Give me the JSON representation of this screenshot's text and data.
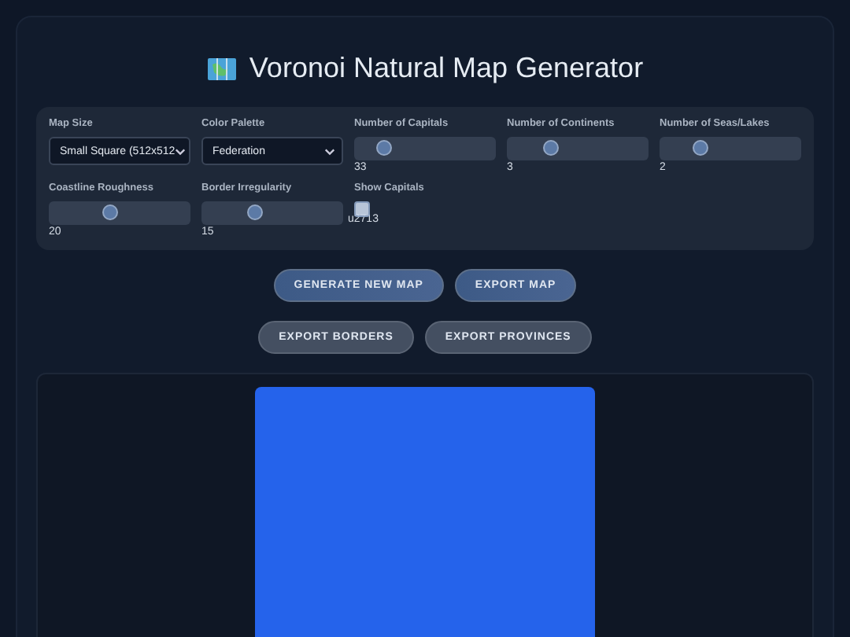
{
  "title": "Voronoi Natural Map Generator",
  "controls": [
    {
      "kind": "select",
      "label": "Map Size",
      "value": "Small Square (512x512"
    },
    {
      "kind": "select",
      "label": "Color Palette",
      "value": "Federation"
    },
    {
      "kind": "slider",
      "label": "Number of Capitals",
      "level": 0.12,
      "reading": "33"
    },
    {
      "kind": "slider",
      "label": "Number of Continents",
      "level": 0.25,
      "reading": "3"
    },
    {
      "kind": "slider",
      "label": "Number of Seas/Lakes",
      "level": 0.23,
      "reading": "2"
    },
    {
      "kind": "slider",
      "label": "Coastline Roughness",
      "level": 0.43,
      "reading": "20"
    },
    {
      "kind": "slider",
      "label": "Border Irregularity",
      "level": 0.35,
      "reading": "15"
    },
    {
      "kind": "checkbox",
      "label": "Show Capitals",
      "checked": true,
      "text": "u2713"
    }
  ],
  "button_rows": [
    [
      {
        "label": "GENERATE NEW MAP",
        "kind": "primary"
      },
      {
        "label": "EXPORT MAP",
        "kind": "primary"
      }
    ],
    [
      {
        "label": "EXPORT BORDERS",
        "kind": "secondary"
      },
      {
        "label": "EXPORT PROVINCES",
        "kind": "secondary"
      }
    ]
  ]
}
